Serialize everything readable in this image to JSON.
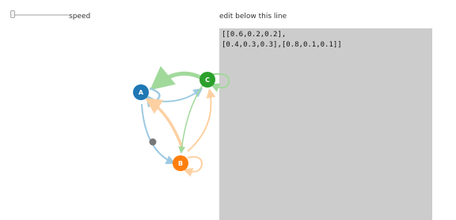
{
  "controls": {
    "speed_label": "speed"
  },
  "editor": {
    "heading": "edit below this line",
    "lines": [
      "[[0.6,0.2,0.2],",
      "[0.4,0.3,0.3],[0.8,0.1,0.1]]"
    ]
  },
  "graph": {
    "nodes": [
      {
        "id": "A",
        "label": "A",
        "color": "#1f77b4"
      },
      {
        "id": "B",
        "label": "B",
        "color": "#ff7f0e"
      },
      {
        "id": "C",
        "label": "C",
        "color": "#2ca02c"
      }
    ],
    "edge_colors": {
      "from_A": "#9ecae1",
      "from_B": "#fdd0a2",
      "from_C": "#a1d99b"
    },
    "marker_color": "#777777"
  }
}
